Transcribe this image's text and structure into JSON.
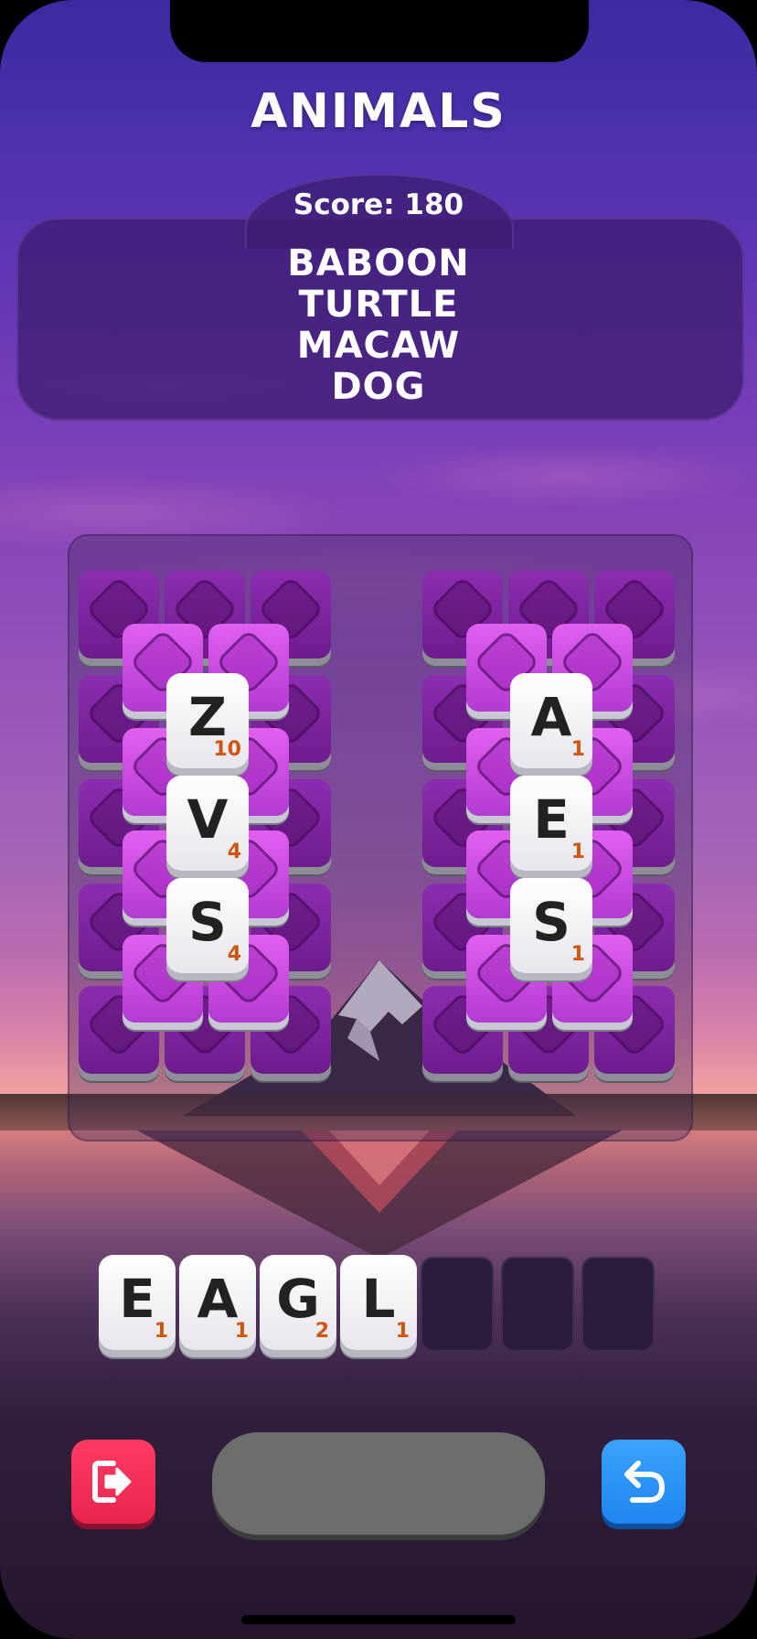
{
  "game": {
    "category": "ANIMALS",
    "score_text": "Score: 180",
    "found_words": [
      "BABOON",
      "TURTLE",
      "MACAW",
      "DOG"
    ]
  },
  "board": {
    "left_stack": [
      {
        "letter": "Z",
        "points": "10"
      },
      {
        "letter": "V",
        "points": "4"
      },
      {
        "letter": "S",
        "points": "4"
      }
    ],
    "right_stack": [
      {
        "letter": "A",
        "points": "1"
      },
      {
        "letter": "E",
        "points": "1"
      },
      {
        "letter": "S",
        "points": "1"
      }
    ]
  },
  "word_builder": {
    "tiles": [
      {
        "letter": "E",
        "points": "1"
      },
      {
        "letter": "A",
        "points": "1"
      },
      {
        "letter": "G",
        "points": "2"
      },
      {
        "letter": "L",
        "points": "1"
      }
    ],
    "empty_slots": 3
  },
  "controls": {
    "exit_icon": "exit-icon",
    "undo_icon": "undo-icon"
  },
  "colors": {
    "exit_button": "#ff3b62",
    "undo_button": "#3aa2ff",
    "submit_button": "#6d6d6d",
    "tile_purple": "#b33ad2",
    "points_orange": "#d0530e"
  }
}
